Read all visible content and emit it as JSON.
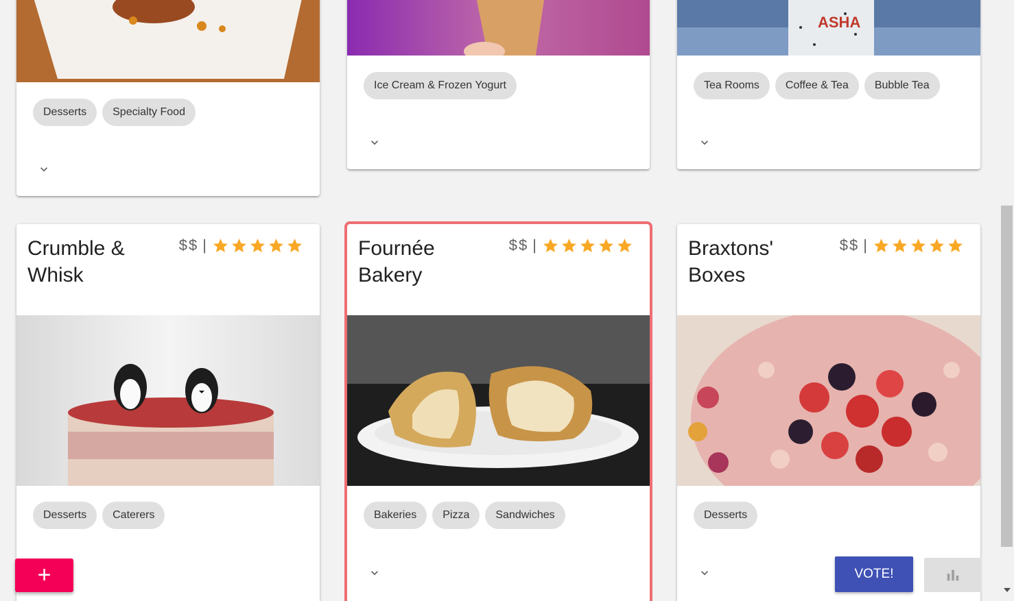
{
  "colors": {
    "background": "#f2f2f2",
    "star": "#f9a825",
    "selected_outline": "#ee6e73",
    "add_button": "#f50057",
    "vote_button": "#3f51b5",
    "chip": "#e0e0e0"
  },
  "top_row": [
    {
      "chips": [
        "Desserts",
        "Specialty Food"
      ]
    },
    {
      "chips": [
        "Ice Cream & Frozen Yogurt"
      ]
    },
    {
      "chips": [
        "Tea Rooms",
        "Coffee & Tea",
        "Bubble Tea"
      ]
    }
  ],
  "bottom_row": [
    {
      "name": "Crumble & Whisk",
      "price": "$$",
      "separator": "|",
      "rating": 5,
      "image": "penguin-cake-photo",
      "chips": [
        "Desserts",
        "Caterers"
      ]
    },
    {
      "name": "Fournée Bakery",
      "price": "$$",
      "separator": "|",
      "rating": 5,
      "image": "croissant-photo",
      "selected": true,
      "chips": [
        "Bakeries",
        "Pizza",
        "Sandwiches"
      ]
    },
    {
      "name": "Braxtons' Boxes",
      "price": "$$",
      "separator": "|",
      "rating": 5,
      "image": "berry-cake-photo",
      "chips": [
        "Desserts"
      ]
    }
  ],
  "actions": {
    "add_label": "+",
    "vote_label": "VOTE!",
    "stats_icon": "bar-chart-icon"
  },
  "icons": {
    "expand": "chevron-down-icon",
    "star": "star-icon"
  }
}
